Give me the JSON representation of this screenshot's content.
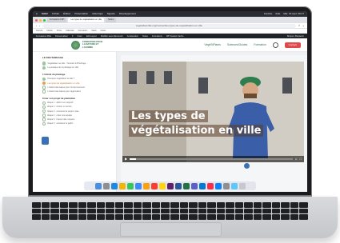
{
  "menubar": {
    "apple": "",
    "app_name": "Safari",
    "items": [
      "Fichier",
      "Édition",
      "Présentation",
      "Historique",
      "Signets",
      "Développement"
    ],
    "right": [
      "Fenêtre",
      "Aide",
      "Mar. 19 sept. 09:17"
    ]
  },
  "browser": {
    "tabs": [
      {
        "label": "Formations FNH"
      },
      {
        "label": "Les types de végétalisation en ville",
        "active": true
      },
      {
        "label": "Notion"
      }
    ],
    "url": "vegetaliserville.org/courses/les-types-de-vegetalisation-en-ville",
    "bookmarks": [
      "Favoris",
      "Notion",
      "Drive",
      "Calendar",
      "Formation",
      "Slack",
      "Notes"
    ]
  },
  "wp_admin": {
    "items": [
      "Formations FNH",
      "Personnaliser",
      "0",
      "Créer",
      "Edit Layout",
      "Modifier avec Elementor",
      "Acceleration",
      "Notes",
      "Formations",
      "WP Fastest Cache"
    ],
    "right": "Bonjour, Benjamin"
  },
  "site": {
    "logo_text": "FONDATION POUR LA NATURE ET L'HOMME",
    "nav": [
      "VégéStPlants",
      "Sciences/Guides",
      "Formation"
    ],
    "cta": "Contact"
  },
  "sidebar": {
    "title": "LE ROUTARDAGE",
    "intro_items": [
      {
        "label": "Végétaliser sa ville - Tutoriels & Brochage",
        "done": true
      },
      {
        "label": "La pratique de la plantage en ville",
        "done": true
      }
    ],
    "section1": "L'intérêt du plantage",
    "section1_items": [
      {
        "label": "Pourquoi végétaliser la ville ?",
        "done": true
      },
      {
        "label": "Les types de végétalisation en ville",
        "current": true
      },
      {
        "label": "L'intérêt des bases pour l'environnement",
        "done": false
      },
      {
        "label": "L'intérêt des bases pour l'agriculture",
        "done": false
      }
    ],
    "section2": "Créer son projet de plantation",
    "section2_items": [
      {
        "label": "Étape 1 : définir son objectif",
        "done": false
      },
      {
        "label": "Étape 2 : choisir un terrain",
        "done": false
      },
      {
        "label": "Étape 3 : concevoir le projet / plan",
        "done": false
      },
      {
        "label": "Étape 4 : créer une équipe",
        "done": false
      },
      {
        "label": "Étape 5 : trouver des moyens",
        "done": false
      },
      {
        "label": "Étape 6 : entretenir le jardin",
        "done": false
      }
    ]
  },
  "video": {
    "title_line1": "Les types de",
    "title_line2": "végétalisation en ville",
    "progress": 0.04,
    "colors": {
      "accent": "#e04a4a",
      "brand": "#2f6f4d"
    }
  },
  "dock": {
    "icons": [
      "finder-icon",
      "launchpad-icon",
      "safari-icon",
      "chrome-icon",
      "messages-icon",
      "mail-icon",
      "photos-icon",
      "calendar-icon",
      "notes-icon",
      "slack-icon",
      "word-icon",
      "excel-icon",
      "teams-icon",
      "outlook-icon",
      "music-icon",
      "appstore-icon",
      "settings-icon",
      "downloads-icon",
      "trash-icon"
    ]
  }
}
